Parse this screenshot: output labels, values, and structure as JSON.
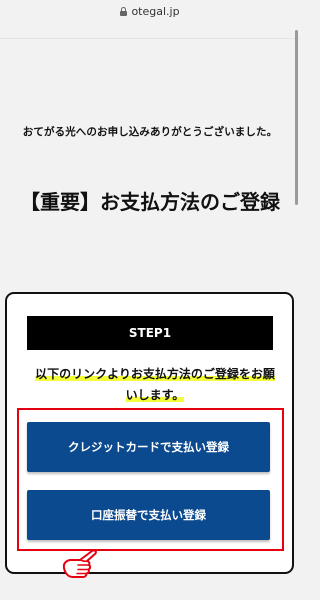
{
  "browser": {
    "url": "otegal.jp",
    "lock_icon": "lock-icon"
  },
  "content": {
    "thanks": "おてがる光へのお申し込みありがとうございました。",
    "headline": "【重要】お支払方法のご登録"
  },
  "step_card": {
    "step_label": "STEP1",
    "instruction": "以下のリンクよりお支払方法のご登録をお願いします。",
    "buttons": {
      "credit": "クレジットカードで支払い登録",
      "bank": "口座振替で支払い登録"
    },
    "highlight_color": "#f4ff3a",
    "frame_color": "#e50012",
    "button_color": "#0b4a8f"
  },
  "pointer_icon": "pointing-hand-icon"
}
